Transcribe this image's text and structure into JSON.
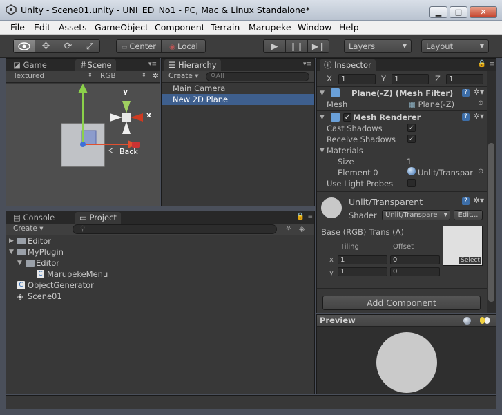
{
  "window": {
    "title": "Unity - Scene01.unity - UNI_ED_No1 - PC, Mac & Linux Standalone*",
    "minimize": "▁",
    "maximize": "□",
    "close": "✕"
  },
  "menu": [
    "File",
    "Edit",
    "Assets",
    "GameObject",
    "Component",
    "Terrain",
    "Marupeke",
    "Window",
    "Help"
  ],
  "toolbar": {
    "pivot": "Center",
    "space": "Local",
    "layers": "Layers",
    "layout": "Layout"
  },
  "scene": {
    "tabs": {
      "game": "Game",
      "scene": "Scene"
    },
    "render_mode": "Textured",
    "channel": "RGB",
    "gizmo": {
      "y": "y",
      "x": "x",
      "back": "Back"
    }
  },
  "hierarchy": {
    "tab": "Hierarchy",
    "create": "Create",
    "search_placeholder": "All",
    "items": [
      "Main Camera",
      "New 2D Plane"
    ]
  },
  "project": {
    "tabs": {
      "console": "Console",
      "project": "Project"
    },
    "create": "Create",
    "items": [
      "Editor",
      "MyPlugin",
      "Editor",
      "MarupekeMenu",
      "ObjectGenerator",
      "Scene01"
    ]
  },
  "inspector": {
    "tab": "Inspector",
    "xyz": {
      "x_label": "X",
      "x": "1",
      "y_label": "Y",
      "y": "1",
      "z_label": "Z",
      "z": "1"
    },
    "mesh_filter": {
      "title": "Plane(-Z) (Mesh Filter)",
      "mesh_label": "Mesh",
      "mesh_value": "Plane(-Z)"
    },
    "mesh_renderer": {
      "title": "Mesh Renderer",
      "cast_shadows": "Cast Shadows",
      "receive_shadows": "Receive Shadows",
      "materials": "Materials",
      "size_label": "Size",
      "size_value": "1",
      "element_label": "Element 0",
      "element_value": "Unlit/Transpar",
      "light_probes": "Use Light Probes",
      "check": "✓"
    },
    "material": {
      "name": "Unlit/Transparent",
      "shader_label": "Shader",
      "shader_value": "Unlit/Transpare",
      "edit": "Edit...",
      "base": "Base (RGB) Trans (A)",
      "tiling": "Tiling",
      "offset": "Offset",
      "x_label": "x",
      "y_label": "y",
      "tiling_x": "1",
      "offset_x": "0",
      "tiling_y": "1",
      "offset_y": "0",
      "select": "Select"
    },
    "add_component": "Add Component",
    "help": "?"
  },
  "preview": {
    "title": "Preview"
  }
}
